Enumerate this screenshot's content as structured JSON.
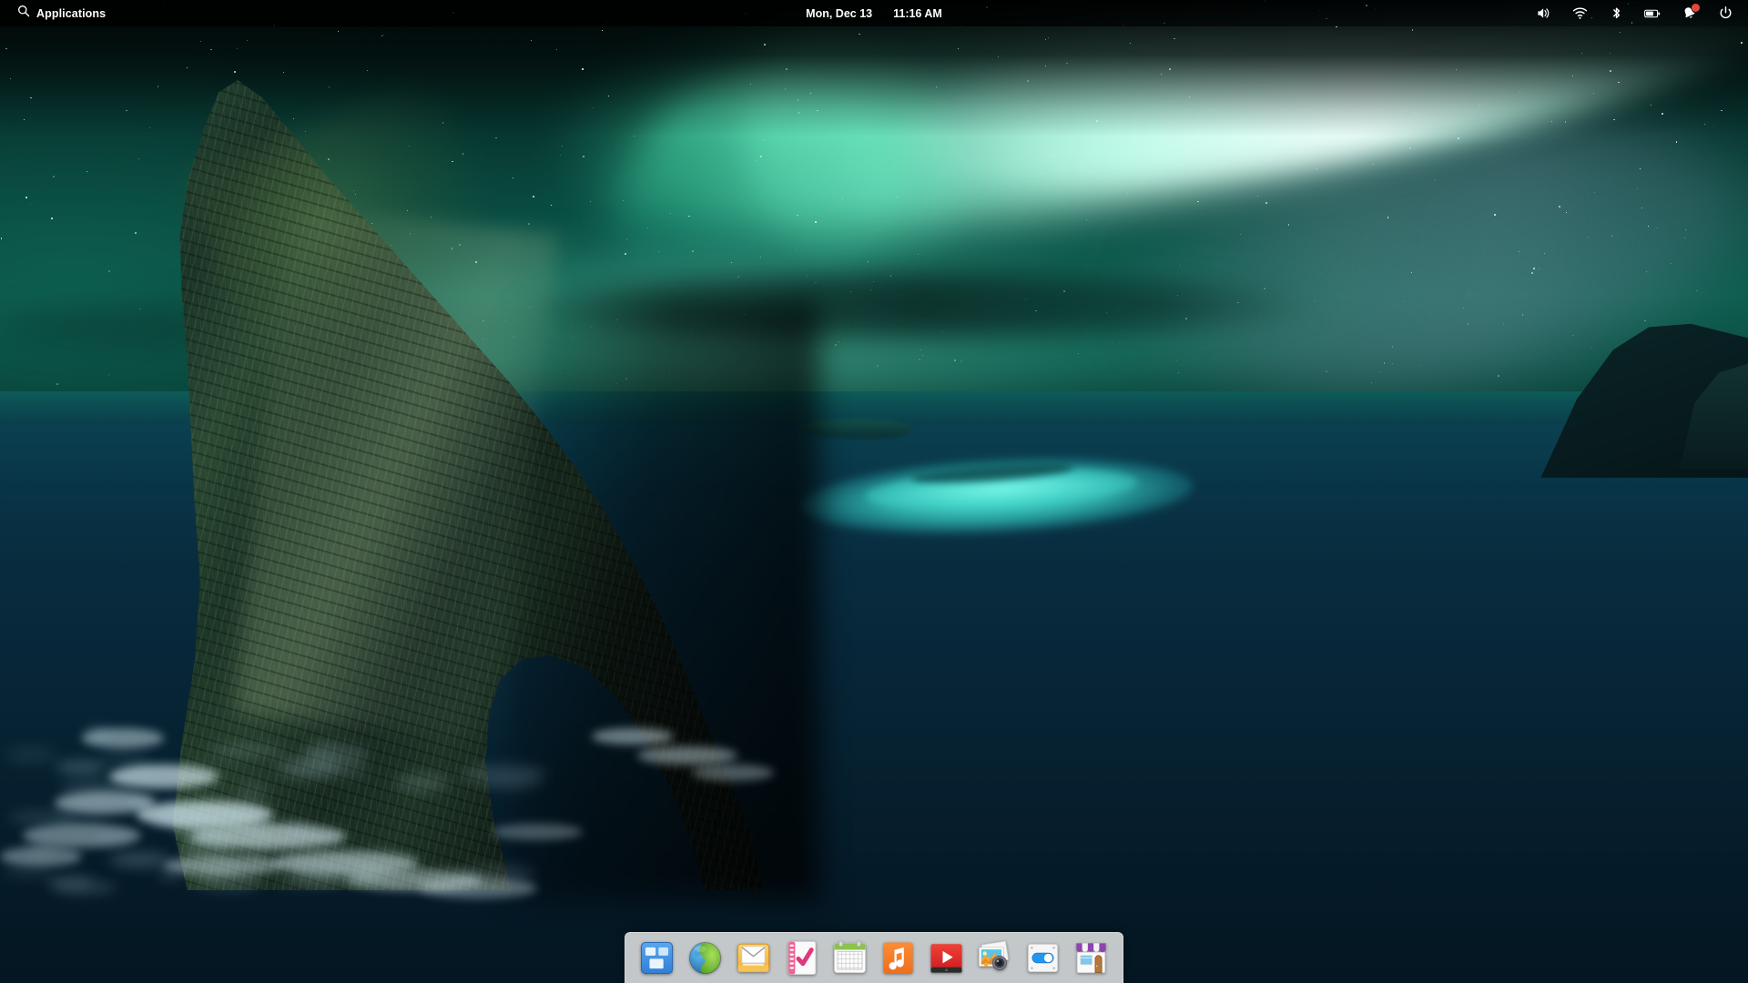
{
  "panel": {
    "applications_label": "Applications",
    "applications_icon": "search-icon",
    "clock_date": "Mon, Dec 13",
    "clock_time": "11:16 AM",
    "tray": [
      {
        "name": "volume-icon",
        "label": "Sound"
      },
      {
        "name": "wifi-icon",
        "label": "Network"
      },
      {
        "name": "bluetooth-icon",
        "label": "Bluetooth"
      },
      {
        "name": "battery-icon",
        "label": "Battery",
        "level_percent": 65
      },
      {
        "name": "notification-bell-icon",
        "label": "Notifications",
        "badge": true
      },
      {
        "name": "power-icon",
        "label": "Session"
      }
    ]
  },
  "dock": {
    "items": [
      {
        "name": "dock-item-files",
        "label": "Files",
        "icon": "files-icon"
      },
      {
        "name": "dock-item-web-browser",
        "label": "Web Browser",
        "icon": "globe-icon"
      },
      {
        "name": "dock-item-mail",
        "label": "Mail",
        "icon": "envelope-icon"
      },
      {
        "name": "dock-item-tasks",
        "label": "Tasks",
        "icon": "notebook-check-icon"
      },
      {
        "name": "dock-item-calendar",
        "label": "Calendar",
        "icon": "calendar-icon"
      },
      {
        "name": "dock-item-music",
        "label": "Music",
        "icon": "music-note-icon"
      },
      {
        "name": "dock-item-videos",
        "label": "Videos",
        "icon": "play-icon"
      },
      {
        "name": "dock-item-photos",
        "label": "Photos",
        "icon": "photo-camera-icon"
      },
      {
        "name": "dock-item-system-settings",
        "label": "System Settings",
        "icon": "toggle-switch-icon"
      },
      {
        "name": "dock-item-appcenter",
        "label": "AppCenter",
        "icon": "storefront-icon"
      }
    ]
  },
  "wallpaper": {
    "description": "Aurora borealis over a sea stack and ocean at night",
    "colors": {
      "sky_deep": "#04100f",
      "sky_teal": "#0c5d4e",
      "aurora_green": "#7dffd2",
      "aurora_white": "#e1fff5",
      "ocean_deep": "#041621",
      "ocean_teal": "#0a4a4a",
      "shoal_turquoise": "#50ebd7",
      "rock_dark": "#16291f"
    }
  }
}
